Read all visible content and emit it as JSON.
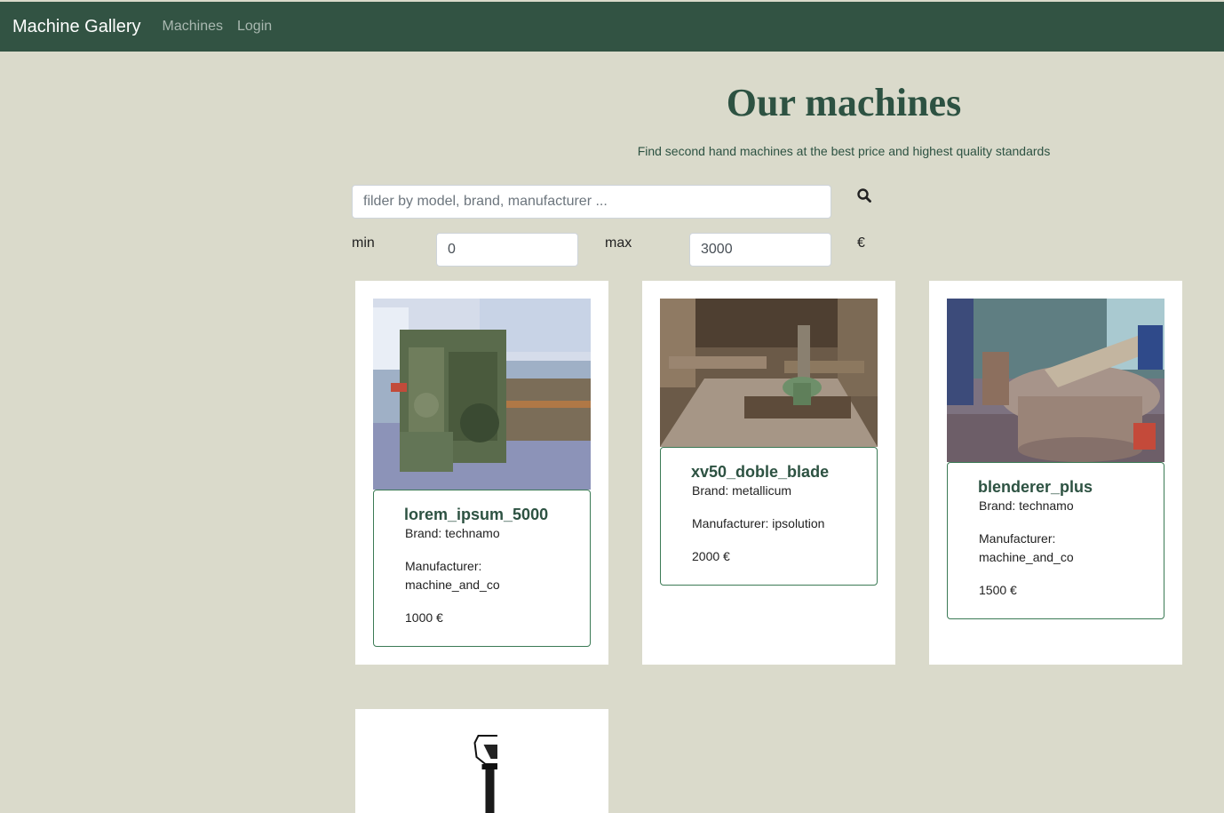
{
  "navbar": {
    "brand": "Machine Gallery",
    "links": [
      "Machines",
      "Login"
    ]
  },
  "header": {
    "title": "Our machines",
    "subtitle": "Find second hand machines at the best price and highest quality standards"
  },
  "filters": {
    "search_placeholder": "filder by model, brand, manufacturer ...",
    "search_icon": "search-icon",
    "min_label": "min",
    "min_value": "0",
    "max_label": "max",
    "max_value": "3000",
    "currency": "€"
  },
  "machines": [
    {
      "name": "lorem_ipsum_5000",
      "brand": "Brand: technamo",
      "manufacturer_label": "Manufacturer:",
      "manufacturer": "machine_and_co",
      "price": "1000 €"
    },
    {
      "name": "xv50_doble_blade",
      "brand": "Brand: metallicum",
      "manufacturer_line": "Manufacturer: ipsolution",
      "price": "2000 €"
    },
    {
      "name": "blenderer_plus",
      "brand": "Brand: technamo",
      "manufacturer_label": "Manufacturer:",
      "manufacturer": "machine_and_co",
      "price": "1500 €"
    }
  ],
  "colors": {
    "navbar": "#325343",
    "background": "#dadacb",
    "accent": "#2d5242"
  }
}
